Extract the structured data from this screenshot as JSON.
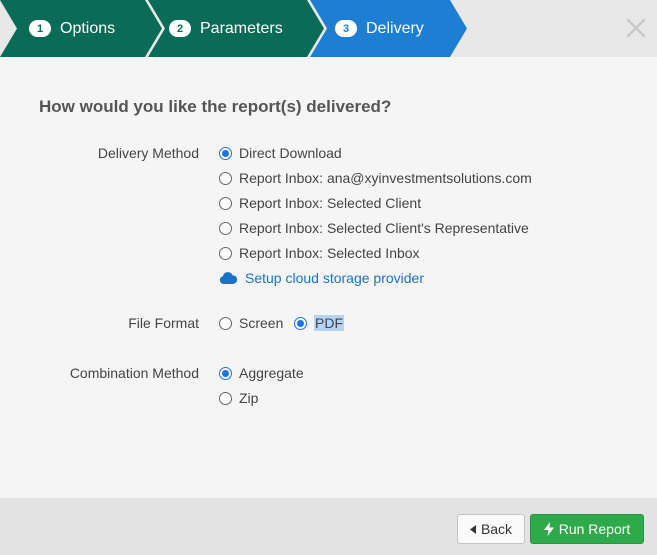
{
  "wizard": {
    "steps": [
      {
        "number": "1",
        "label": "Options"
      },
      {
        "number": "2",
        "label": "Parameters"
      },
      {
        "number": "3",
        "label": "Delivery"
      }
    ],
    "active_step": 3,
    "colors": {
      "done": "#0a6b56",
      "active": "#1e7fd2"
    },
    "close_icon": "close-icon"
  },
  "main": {
    "question": "How would you like the report(s) delivered?",
    "delivery_method": {
      "label": "Delivery Method",
      "options": [
        {
          "label": "Direct Download",
          "checked": true
        },
        {
          "label": "Report Inbox: ana@xyinvestmentsolutions.com",
          "checked": false
        },
        {
          "label": "Report Inbox: Selected Client",
          "checked": false
        },
        {
          "label": "Report Inbox: Selected Client's Representative",
          "checked": false
        },
        {
          "label": "Report Inbox: Selected Inbox",
          "checked": false
        }
      ],
      "cloud_link": "Setup cloud storage provider",
      "cloud_icon": "cloud-icon"
    },
    "file_format": {
      "label": "File Format",
      "options": [
        {
          "label": "Screen",
          "checked": false
        },
        {
          "label": "PDF",
          "checked": true
        }
      ]
    },
    "combination_method": {
      "label": "Combination Method",
      "options": [
        {
          "label": "Aggregate",
          "checked": true
        },
        {
          "label": "Zip",
          "checked": false
        }
      ]
    }
  },
  "footer": {
    "back_label": "Back",
    "back_icon": "caret-left-icon",
    "run_label": "Run Report",
    "run_icon": "bolt-icon",
    "run_color": "#2eaa4a"
  }
}
